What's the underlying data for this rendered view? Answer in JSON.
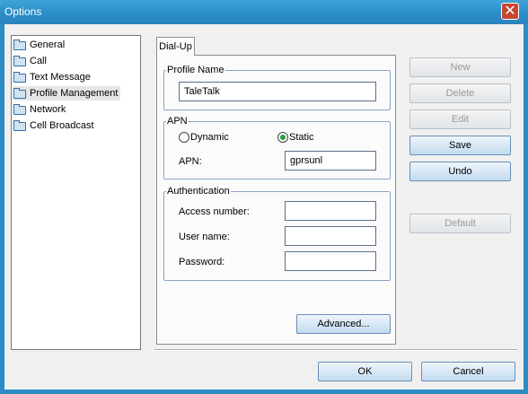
{
  "window": {
    "title": "Options",
    "close_glyph": "✕"
  },
  "tree": {
    "items": [
      {
        "label": "General",
        "icon": "folder-icon"
      },
      {
        "label": "Call",
        "icon": "folder-icon"
      },
      {
        "label": "Text Message",
        "icon": "folder-icon"
      },
      {
        "label": "Profile Management",
        "icon": "folder-open-icon",
        "selected": true
      },
      {
        "label": "Network",
        "icon": "folder-icon"
      },
      {
        "label": "Cell Broadcast",
        "icon": "folder-icon"
      }
    ]
  },
  "tabs": [
    {
      "label": "Dial-Up",
      "active": true
    }
  ],
  "profile": {
    "legend": "Profile Name",
    "value": "TaleTalk"
  },
  "apn": {
    "legend": "APN",
    "dynamic_label": "Dynamic",
    "static_label": "Static",
    "selected": "Static",
    "apn_label": "APN:",
    "apn_value": "gprsunl"
  },
  "auth": {
    "legend": "Authentication",
    "access_label": "Access number:",
    "access_value": "",
    "user_label": "User name:",
    "user_value": "",
    "password_label": "Password:",
    "password_value": ""
  },
  "buttons": {
    "advanced": "Advanced...",
    "new": "New",
    "delete": "Delete",
    "edit": "Edit",
    "save": "Save",
    "undo": "Undo",
    "default": "Default",
    "ok": "OK",
    "cancel": "Cancel"
  },
  "colors": {
    "title_bar": "#2b8cc6",
    "close_button": "#c7462f",
    "radio_selected": "#2a9d3c"
  }
}
